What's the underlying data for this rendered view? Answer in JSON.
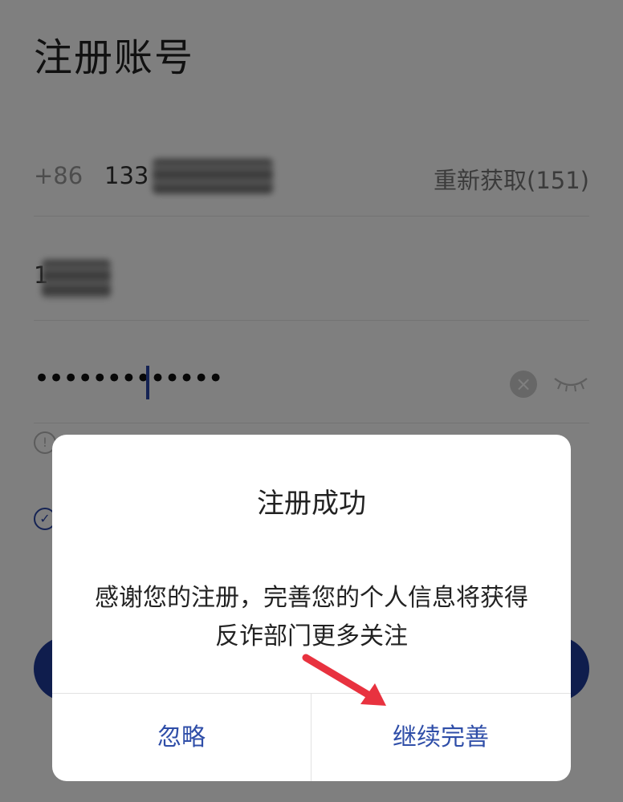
{
  "page": {
    "title": "注册账号"
  },
  "phone_row": {
    "country_code": "+86",
    "phone_visible": "133",
    "resend_label": "重新获取(151)"
  },
  "code_row": {
    "code_visible": "1"
  },
  "password_row": {
    "masked_value": "•••••••••••••"
  },
  "dialog": {
    "title": "注册成功",
    "message": "感谢您的注册，完善您的个人信息将获得反诈部门更多关注",
    "ignore_label": "忽略",
    "continue_label": "继续完善"
  },
  "colors": {
    "brand_blue": "#1e3a9b",
    "dialog_button_text": "#2f4ea8",
    "arrow": "#e8323f"
  },
  "icons": [
    "clear-icon",
    "eye-closed-icon",
    "info-icon",
    "check-icon",
    "red-arrow-annotation"
  ]
}
